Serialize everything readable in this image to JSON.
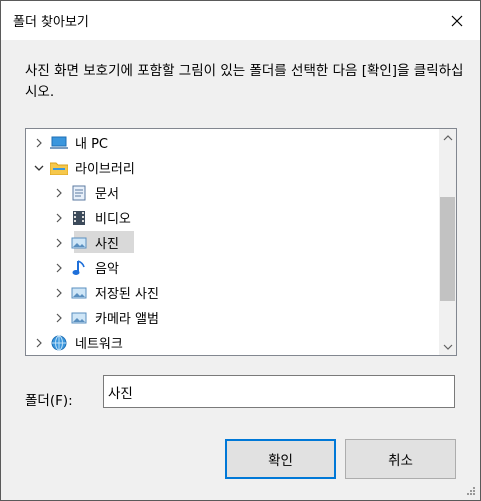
{
  "window": {
    "title": "폴더 찾아보기",
    "close_icon": "close-icon"
  },
  "instruction": "사진 화면 보호기에 포함할 그림이 있는 폴더를 선택한 다음 [확인]을 클릭하십시오.",
  "tree": [
    {
      "label": "내 PC",
      "icon": "pc-icon",
      "expanded": false
    },
    {
      "label": "라이브러리",
      "icon": "library-folder-icon",
      "expanded": true
    },
    {
      "label": "문서",
      "icon": "documents-icon",
      "expanded": false
    },
    {
      "label": "비디오",
      "icon": "video-icon",
      "expanded": false
    },
    {
      "label": "사진",
      "icon": "pictures-icon",
      "expanded": false,
      "selected": true
    },
    {
      "label": "음악",
      "icon": "music-icon",
      "expanded": false
    },
    {
      "label": "저장된 사진",
      "icon": "saved-pictures-icon",
      "expanded": false
    },
    {
      "label": "카메라 앨범",
      "icon": "camera-roll-icon",
      "expanded": false
    },
    {
      "label": "네트워크",
      "icon": "network-icon",
      "expanded": false
    }
  ],
  "folder_field": {
    "label": "폴더(F):",
    "value": "사진"
  },
  "buttons": {
    "ok": "확인",
    "cancel": "취소"
  }
}
